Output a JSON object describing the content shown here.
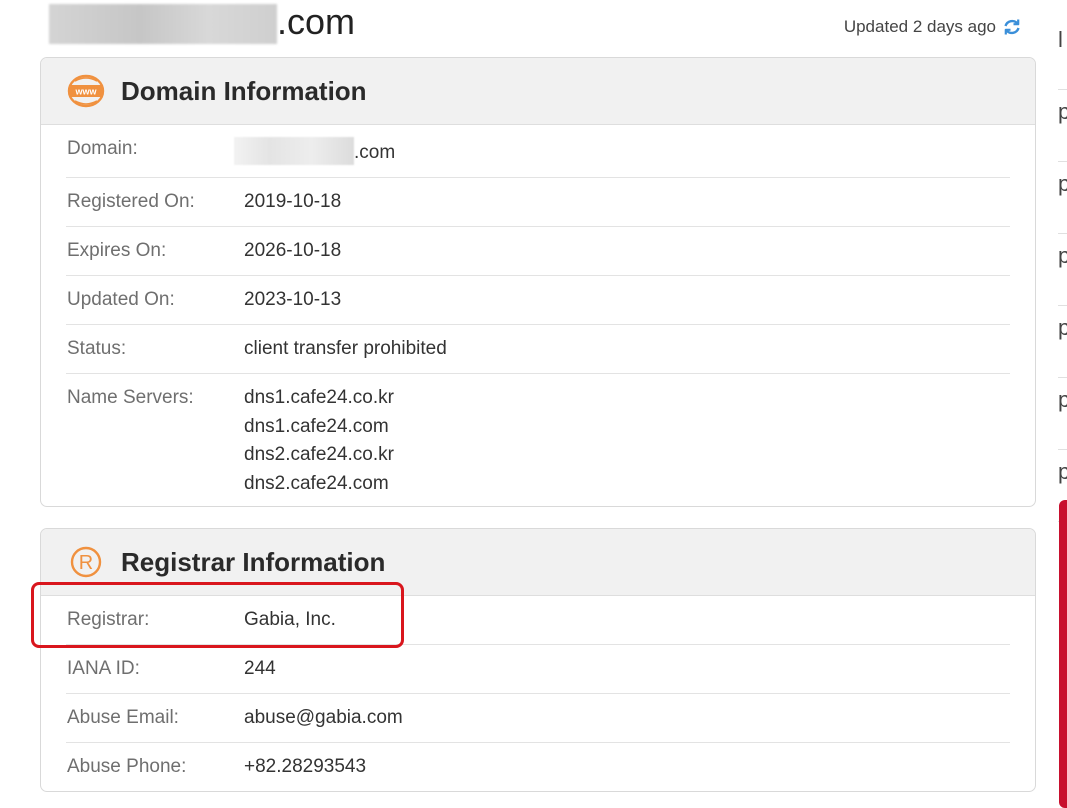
{
  "header": {
    "domain_suffix": ".com",
    "updated_text": "Updated 2 days ago"
  },
  "domain_info": {
    "title": "Domain Information",
    "icon": "www-icon",
    "rows": {
      "domain": {
        "label": "Domain:",
        "value": ".com"
      },
      "registered": {
        "label": "Registered On:",
        "value": "2019-10-18"
      },
      "expires": {
        "label": "Expires On:",
        "value": "2026-10-18"
      },
      "updated": {
        "label": "Updated On:",
        "value": "2023-10-13"
      },
      "status": {
        "label": "Status:",
        "value": "client transfer prohibited"
      },
      "name_servers": {
        "label": "Name Servers:",
        "values": [
          "dns1.cafe24.co.kr",
          "dns1.cafe24.com",
          "dns2.cafe24.co.kr",
          "dns2.cafe24.com"
        ]
      }
    }
  },
  "registrar_info": {
    "title": "Registrar Information",
    "icon": "registered-icon",
    "rows": {
      "registrar": {
        "label": "Registrar:",
        "value": "Gabia, Inc."
      },
      "iana": {
        "label": "IANA ID:",
        "value": "244"
      },
      "abuse_email": {
        "label": "Abuse Email:",
        "value": "abuse@gabia.com"
      },
      "abuse_phone": {
        "label": "Abuse Phone:",
        "value": "+82.28293543"
      }
    }
  },
  "sidebar_partial": {
    "letters": [
      "l",
      "p",
      "p",
      "p",
      "p",
      "p",
      "p"
    ]
  },
  "colors": {
    "accent_orange": "#f0913f",
    "refresh_blue": "#3a8fd9",
    "highlight_red": "#d9161d"
  }
}
